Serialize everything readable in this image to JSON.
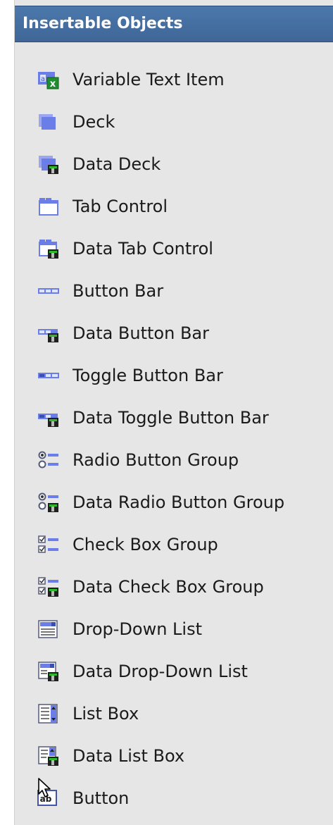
{
  "panel": {
    "title": "Insertable Objects",
    "items": [
      {
        "label": "Variable Text Item",
        "icon": "variable-text-item-icon"
      },
      {
        "label": "Deck",
        "icon": "deck-icon"
      },
      {
        "label": "Data Deck",
        "icon": "data-deck-icon"
      },
      {
        "label": "Tab Control",
        "icon": "tab-control-icon"
      },
      {
        "label": "Data Tab Control",
        "icon": "data-tab-control-icon"
      },
      {
        "label": "Button Bar",
        "icon": "button-bar-icon"
      },
      {
        "label": "Data Button Bar",
        "icon": "data-button-bar-icon"
      },
      {
        "label": "Toggle Button Bar",
        "icon": "toggle-button-bar-icon"
      },
      {
        "label": "Data Toggle Button Bar",
        "icon": "data-toggle-button-bar-icon"
      },
      {
        "label": "Radio Button Group",
        "icon": "radio-button-group-icon"
      },
      {
        "label": "Data Radio Button Group",
        "icon": "data-radio-button-group-icon"
      },
      {
        "label": "Check Box Group",
        "icon": "check-box-group-icon"
      },
      {
        "label": "Data Check Box Group",
        "icon": "data-check-box-group-icon"
      },
      {
        "label": "Drop-Down List",
        "icon": "drop-down-list-icon"
      },
      {
        "label": "Data Drop-Down List",
        "icon": "data-drop-down-list-icon"
      },
      {
        "label": "List Box",
        "icon": "list-box-icon"
      },
      {
        "label": "Data List Box",
        "icon": "data-list-box-icon"
      },
      {
        "label": "Button",
        "icon": "button-icon"
      }
    ]
  },
  "colors": {
    "header_background": "#4472a4",
    "panel_background": "#e6e6e6",
    "icon_blue": "#6b7ee8",
    "data_overlay": "#1f1f1f",
    "data_accent": "#2db82d",
    "excel_green": "#1e8e2e"
  }
}
